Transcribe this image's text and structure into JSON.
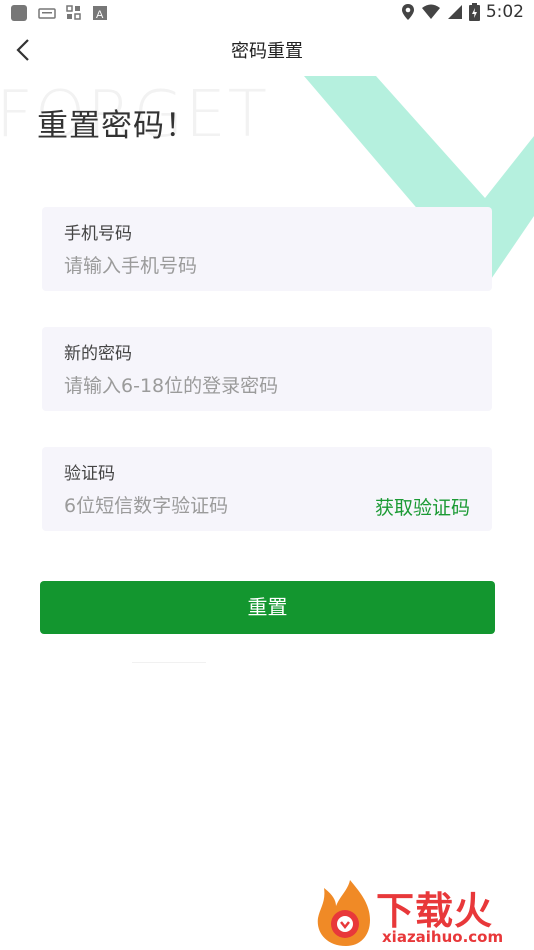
{
  "status_bar": {
    "time": "5:02"
  },
  "header": {
    "title": "密码重置"
  },
  "decor": {
    "ghost_word": "FORGET"
  },
  "page_title": "重置密码！",
  "fields": {
    "phone": {
      "label": "手机号码",
      "placeholder": "请输入手机号码"
    },
    "password": {
      "label": "新的密码",
      "placeholder": "请输入6-18位的登录密码"
    },
    "code": {
      "label": "验证码",
      "placeholder": "6位短信数字验证码",
      "action": "获取验证码"
    }
  },
  "submit_label": "重置",
  "watermark": {
    "brand": "下载火",
    "url": "xiazaihuo.com"
  },
  "colors": {
    "accent": "#13962f",
    "link": "#1b9a34",
    "field_bg": "#f6f5fb",
    "check": "#b5f0de",
    "watermark": "#e8383a"
  }
}
